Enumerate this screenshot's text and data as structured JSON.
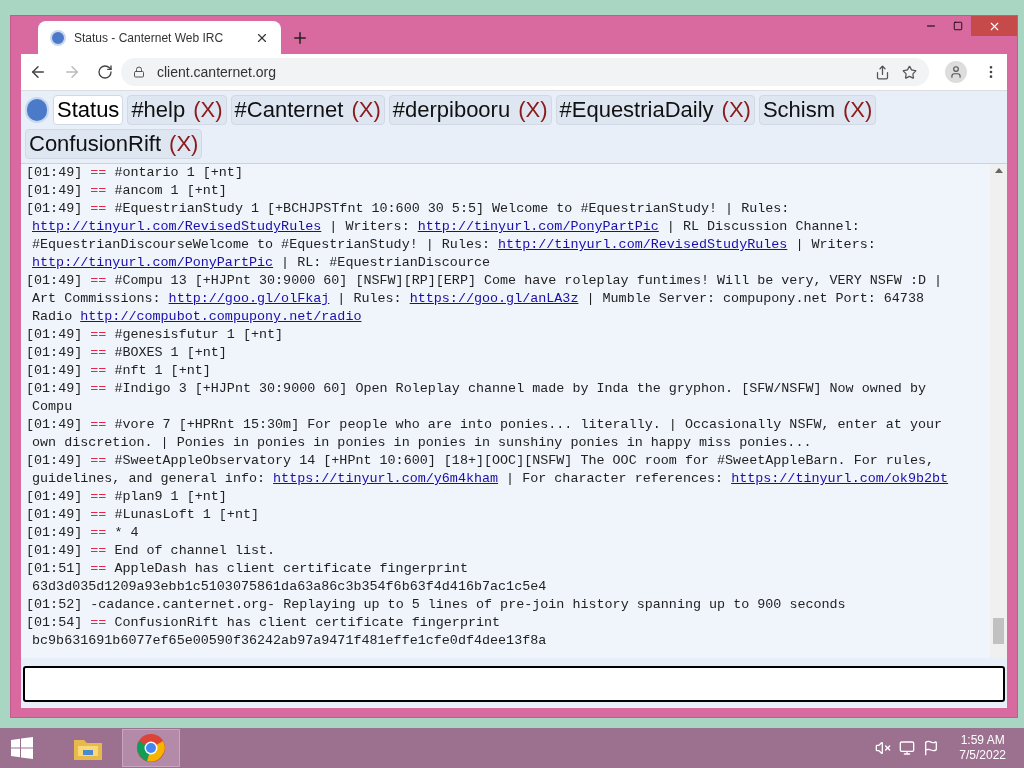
{
  "browser": {
    "tab_title": "Status - Canternet Web IRC",
    "url": "client.canternet.org"
  },
  "channel_tabs": [
    {
      "label": "Status",
      "selected": true
    },
    {
      "label": "#help",
      "close": "(X)",
      "selected": false
    },
    {
      "label": "#Canternet",
      "close": "(X)",
      "selected": false
    },
    {
      "label": "#derpibooru",
      "close": "(X)",
      "selected": false
    },
    {
      "label": "#EquestriaDaily",
      "close": "(X)",
      "selected": false
    },
    {
      "label": "Schism",
      "close": "(X)",
      "selected": false
    },
    {
      "label": "ConfusionRift",
      "close": "(X)",
      "selected": false
    }
  ],
  "messages": [
    {
      "time": "[01:49]",
      "marker": "==",
      "rows": [
        {
          "parts": [
            {
              "kind": "text",
              "text": "#ontario 1 [+nt]"
            }
          ]
        }
      ]
    },
    {
      "time": "[01:49]",
      "marker": "==",
      "rows": [
        {
          "parts": [
            {
              "kind": "text",
              "text": "#ancom 1 [+nt]"
            }
          ]
        }
      ]
    },
    {
      "time": "[01:49]",
      "marker": "==",
      "rows": [
        {
          "parts": [
            {
              "kind": "text",
              "text": "#EquestrianStudy 1 [+BCHJPSTfnt 10:600 30 5:5] Welcome to #EquestrianStudy! | Rules:"
            }
          ]
        },
        {
          "parts": [
            {
              "kind": "link",
              "text": "http://tinyurl.com/RevisedStudyRules"
            },
            {
              "kind": "text",
              "text": " | Writers: "
            },
            {
              "kind": "link",
              "text": "http://tinyurl.com/PonyPartPic"
            },
            {
              "kind": "text",
              "text": " | RL Discussion Channel:"
            }
          ]
        },
        {
          "parts": [
            {
              "kind": "text",
              "text": "#EquestrianDiscourseWelcome to #EquestrianStudy! | Rules: "
            },
            {
              "kind": "link",
              "text": "http://tinyurl.com/RevisedStudyRules"
            },
            {
              "kind": "text",
              "text": " | Writers:"
            }
          ]
        },
        {
          "parts": [
            {
              "kind": "link",
              "text": "http://tinyurl.com/PonyPartPic"
            },
            {
              "kind": "text",
              "text": " | RL: #EquestrianDiscource"
            }
          ]
        }
      ]
    },
    {
      "time": "[01:49]",
      "marker": "==",
      "rows": [
        {
          "parts": [
            {
              "kind": "text",
              "text": "#Compu 13 [+HJPnt 30:9000 60] [NSFW][RP][ERP] Come have roleplay funtimes! Will be very, VERY NSFW :D |"
            }
          ]
        },
        {
          "parts": [
            {
              "kind": "text",
              "text": "Art Commissions: "
            },
            {
              "kind": "link",
              "text": "http://goo.gl/olFkaj"
            },
            {
              "kind": "text",
              "text": " | Rules: "
            },
            {
              "kind": "link",
              "text": "https://goo.gl/anLA3z"
            },
            {
              "kind": "text",
              "text": " | Mumble Server: compupony.net Port: 64738"
            }
          ]
        },
        {
          "parts": [
            {
              "kind": "text",
              "text": "Radio "
            },
            {
              "kind": "link",
              "text": "http://compubot.compupony.net/radio"
            }
          ]
        }
      ]
    },
    {
      "time": "[01:49]",
      "marker": "==",
      "rows": [
        {
          "parts": [
            {
              "kind": "text",
              "text": "#genesisfutur 1 [+nt]"
            }
          ]
        }
      ]
    },
    {
      "time": "[01:49]",
      "marker": "==",
      "rows": [
        {
          "parts": [
            {
              "kind": "text",
              "text": "#BOXES 1 [+nt]"
            }
          ]
        }
      ]
    },
    {
      "time": "[01:49]",
      "marker": "==",
      "rows": [
        {
          "parts": [
            {
              "kind": "text",
              "text": "#nft 1 [+nt]"
            }
          ]
        }
      ]
    },
    {
      "time": "[01:49]",
      "marker": "==",
      "rows": [
        {
          "parts": [
            {
              "kind": "text",
              "text": "#Indigo 3 [+HJPnt 30:9000 60] Open Roleplay channel made by Inda the gryphon. [SFW/NSFW] Now owned by"
            }
          ]
        },
        {
          "parts": [
            {
              "kind": "text",
              "text": "Compu"
            }
          ]
        }
      ]
    },
    {
      "time": "[01:49]",
      "marker": "==",
      "rows": [
        {
          "parts": [
            {
              "kind": "text",
              "text": "#vore 7 [+HPRnt 15:30m] For people who are into ponies... literally. | Occasionally NSFW, enter at your"
            }
          ]
        },
        {
          "parts": [
            {
              "kind": "text",
              "text": "own discretion. | Ponies in ponies in ponies in ponies in sunshiny ponies in happy miss ponies..."
            }
          ]
        }
      ]
    },
    {
      "time": "[01:49]",
      "marker": "==",
      "rows": [
        {
          "parts": [
            {
              "kind": "text",
              "text": "#SweetAppleObservatory 14 [+HPnt 10:600] [18+][OOC][NSFW] The OOC room for #SweetAppleBarn. For rules,"
            }
          ]
        },
        {
          "parts": [
            {
              "kind": "text",
              "text": "guidelines, and general info: "
            },
            {
              "kind": "link",
              "text": "https://tinyurl.com/y6m4kham"
            },
            {
              "kind": "text",
              "text": " | For character references: "
            },
            {
              "kind": "link",
              "text": "https://tinyurl.com/ok9b2bt"
            }
          ]
        }
      ]
    },
    {
      "time": "[01:49]",
      "marker": "==",
      "rows": [
        {
          "parts": [
            {
              "kind": "text",
              "text": "#plan9 1 [+nt]"
            }
          ]
        }
      ]
    },
    {
      "time": "[01:49]",
      "marker": "==",
      "rows": [
        {
          "parts": [
            {
              "kind": "text",
              "text": "#LunasLoft 1 [+nt]"
            }
          ]
        }
      ]
    },
    {
      "time": "[01:49]",
      "marker": "==",
      "rows": [
        {
          "parts": [
            {
              "kind": "text",
              "text": "* 4"
            }
          ]
        }
      ]
    },
    {
      "time": "[01:49]",
      "marker": "==",
      "rows": [
        {
          "parts": [
            {
              "kind": "text",
              "text": "End of channel list."
            }
          ]
        }
      ]
    },
    {
      "time": "[01:51]",
      "marker": "==",
      "rows": [
        {
          "parts": [
            {
              "kind": "text",
              "text": "AppleDash has client certificate fingerprint"
            }
          ]
        },
        {
          "parts": [
            {
              "kind": "text",
              "text": "63d3d035d1209a93ebb1c5103075861da63a86c3b354f6b63f4d416b7ac1c5e4"
            }
          ]
        }
      ]
    },
    {
      "time": "[01:52]",
      "rows": [
        {
          "parts": [
            {
              "kind": "text",
              "text": "-cadance.canternet.org- Replaying up to 5 lines of pre-join history spanning up to 900 seconds"
            }
          ]
        }
      ]
    },
    {
      "time": "[01:54]",
      "marker": "==",
      "rows": [
        {
          "parts": [
            {
              "kind": "text",
              "text": "ConfusionRift has client certificate fingerprint"
            }
          ]
        },
        {
          "parts": [
            {
              "kind": "text",
              "text": "bc9b631691b6077ef65e00590f36242ab97a9471f481effe1cfe0df4dee13f8a"
            }
          ]
        }
      ]
    }
  ],
  "taskbar": {
    "time": "1:59 AM",
    "date": "7/5/2022"
  }
}
